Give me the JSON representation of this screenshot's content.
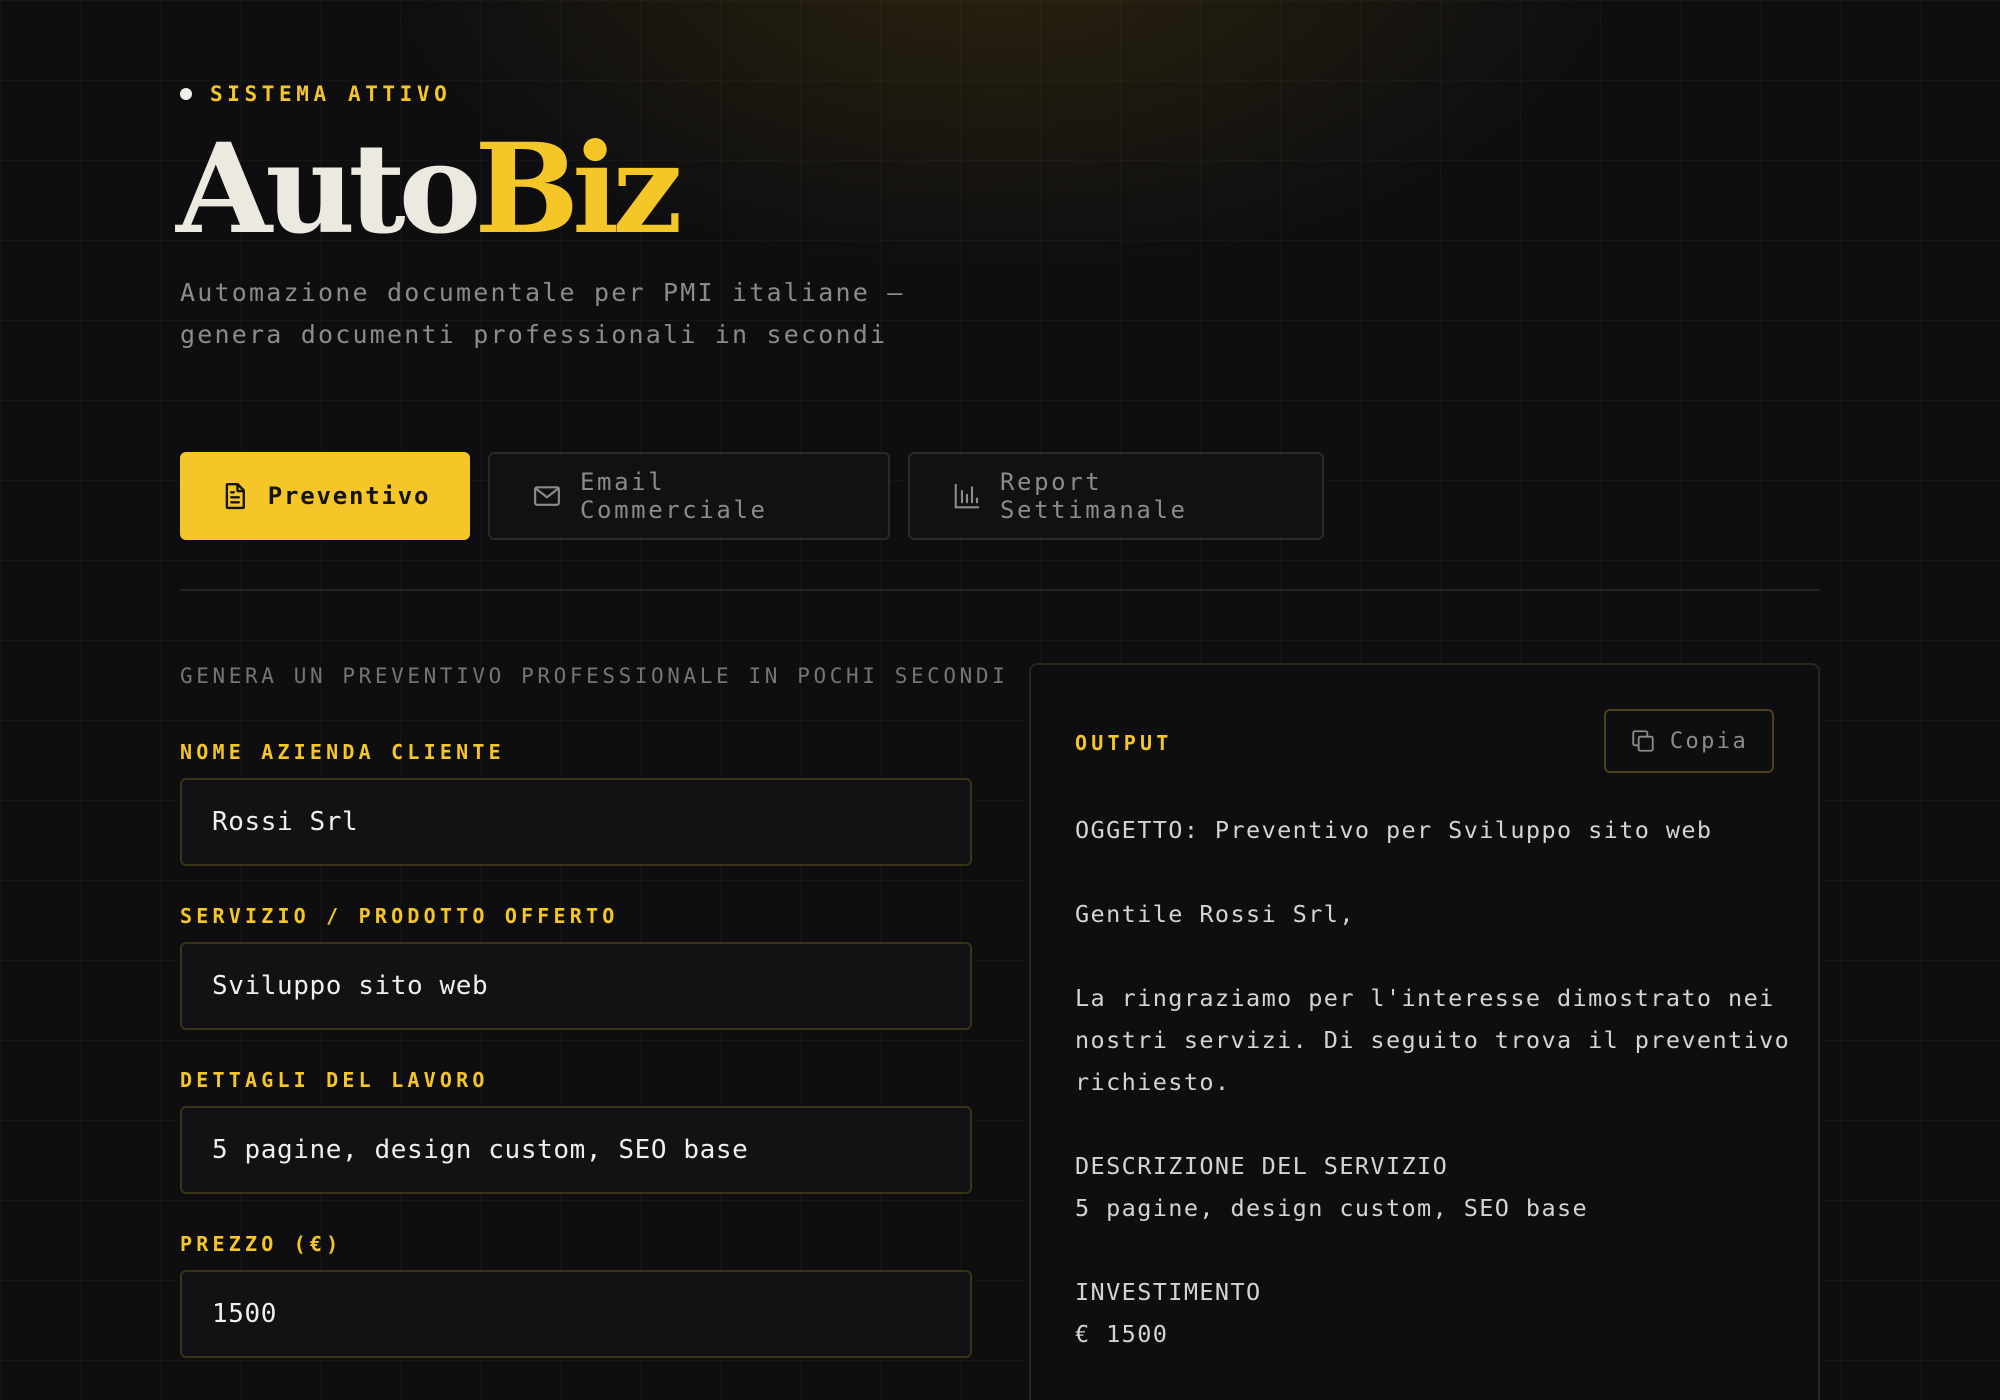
{
  "header": {
    "status": "SISTEMA ATTIVO",
    "logo_part1": "Auto",
    "logo_part2": "Biz",
    "tagline_line1": "Automazione documentale per PMI italiane —",
    "tagline_line2": "genera documenti professionali in secondi"
  },
  "tabs": [
    {
      "label": "Preventivo",
      "icon": "document-icon",
      "active": true
    },
    {
      "label": "Email Commerciale",
      "icon": "mail-icon",
      "active": false
    },
    {
      "label": "Report Settimanale",
      "icon": "bar-chart-icon",
      "active": false
    }
  ],
  "form": {
    "subtitle": "GENERA UN PREVENTIVO PROFESSIONALE IN POCHI SECONDI",
    "fields": [
      {
        "label": "NOME AZIENDA CLIENTE",
        "value": "Rossi Srl"
      },
      {
        "label": "SERVIZIO / PRODOTTO OFFERTO",
        "value": "Sviluppo sito web"
      },
      {
        "label": "DETTAGLI DEL LAVORO",
        "value": "5 pagine, design custom, SEO base"
      },
      {
        "label": "PREZZO (€)",
        "value": "1500"
      }
    ]
  },
  "output": {
    "label": "OUTPUT",
    "copy_label": "Copia",
    "subject": "OGGETTO: Preventivo per Sviluppo sito web",
    "greeting": "Gentile Rossi Srl,",
    "intro_line1": "La ringraziamo per l'interesse dimostrato nei",
    "intro_line2": "nostri servizi. Di seguito trova il preventivo",
    "intro_line3": "richiesto.",
    "description_heading": "DESCRIZIONE DEL SERVIZIO",
    "description_text": "5 pagine, design custom, SEO base",
    "investment_heading": "INVESTIMENTO",
    "investment_value": "€ 1500"
  },
  "colors": {
    "accent": "#f5c628",
    "background": "#0e0e10",
    "muted_text": "#8c8b86"
  }
}
